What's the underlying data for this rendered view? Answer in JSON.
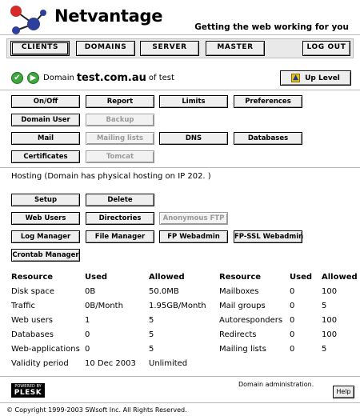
{
  "brand": {
    "name": "Netvantage",
    "tagline": "Getting the web working for you"
  },
  "nav": {
    "clients": "CLIENTS",
    "domains": "DOMAINS",
    "server": "SERVER",
    "master": "MASTER",
    "logout": "LOG OUT"
  },
  "domain": {
    "prefix": "Domain",
    "name": "test.com.au",
    "of": "of test"
  },
  "uplevel": "Up Level",
  "buttons": {
    "onoff": "On/Off",
    "report": "Report",
    "limits": "Limits",
    "preferences": "Preferences",
    "domain_user": "Domain User",
    "backup": "Backup",
    "mail": "Mail",
    "mailing_lists": "Mailing lists",
    "dns": "DNS",
    "databases": "Databases",
    "certificates": "Certificates",
    "tomcat": "Tomcat"
  },
  "hosting": "Hosting (Domain has physical hosting on IP 202.                    )",
  "hosting_buttons": {
    "setup": "Setup",
    "delete": "Delete",
    "web_users": "Web Users",
    "directories": "Directories",
    "anon_ftp": "Anonymous FTP",
    "log_manager": "Log Manager",
    "file_manager": "File Manager",
    "fp_webadmin": "FP Webadmin",
    "fp_ssl_webadmin": "FP-SSL Webadmin",
    "crontab_manager": "Crontab Manager"
  },
  "stats_left": {
    "headers": {
      "resource": "Resource",
      "used": "Used",
      "allowed": "Allowed"
    },
    "rows": [
      {
        "resource": "Disk space",
        "used": "0B",
        "allowed": "50.0MB"
      },
      {
        "resource": "Traffic",
        "used": "0B/Month",
        "allowed": "1.95GB/Month"
      },
      {
        "resource": "Web users",
        "used": "1",
        "allowed": "5"
      },
      {
        "resource": "Databases",
        "used": "0",
        "allowed": "5"
      },
      {
        "resource": "Web-applications",
        "used": "0",
        "allowed": "5"
      },
      {
        "resource": "Validity period",
        "used": "10 Dec 2003",
        "allowed": "Unlimited"
      }
    ]
  },
  "stats_right": {
    "headers": {
      "resource": "Resource",
      "used": "Used",
      "allowed": "Allowed"
    },
    "rows": [
      {
        "resource": "Mailboxes",
        "used": "0",
        "allowed": "100"
      },
      {
        "resource": "Mail groups",
        "used": "0",
        "allowed": "5"
      },
      {
        "resource": "Autoresponders",
        "used": "0",
        "allowed": "100"
      },
      {
        "resource": "Redirects",
        "used": "0",
        "allowed": "100"
      },
      {
        "resource": "Mailing lists",
        "used": "0",
        "allowed": "5"
      }
    ]
  },
  "footer": {
    "powered_by": "POWERED BY",
    "plesk": "PLESK",
    "text": "Domain administration.",
    "help": "Help",
    "copyright": "© Copyright 1999-2003 SWsoft Inc. All Rights Reserved."
  }
}
